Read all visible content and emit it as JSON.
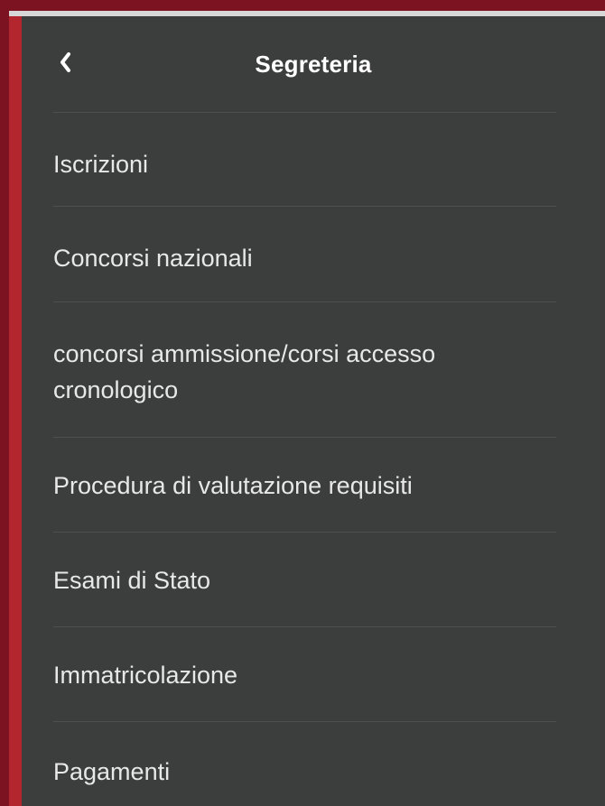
{
  "header": {
    "title": "Segreteria",
    "back_icon": "chevron-left-icon"
  },
  "menu": {
    "items": [
      {
        "label": "Iscrizioni"
      },
      {
        "label": "Concorsi nazionali"
      },
      {
        "label": "concorsi ammissione/corsi accesso cronologico"
      },
      {
        "label": "Procedura di valutazione requisiti"
      },
      {
        "label": "Esami di Stato"
      },
      {
        "label": "Immatricolazione"
      },
      {
        "label": "Pagamenti"
      }
    ]
  },
  "colors": {
    "frame": "#7b1420",
    "accent": "#b3262e",
    "panel": "#3c3e3d",
    "divider": "#4d504f",
    "text": "#e8e8e8",
    "title": "#ffffff"
  }
}
